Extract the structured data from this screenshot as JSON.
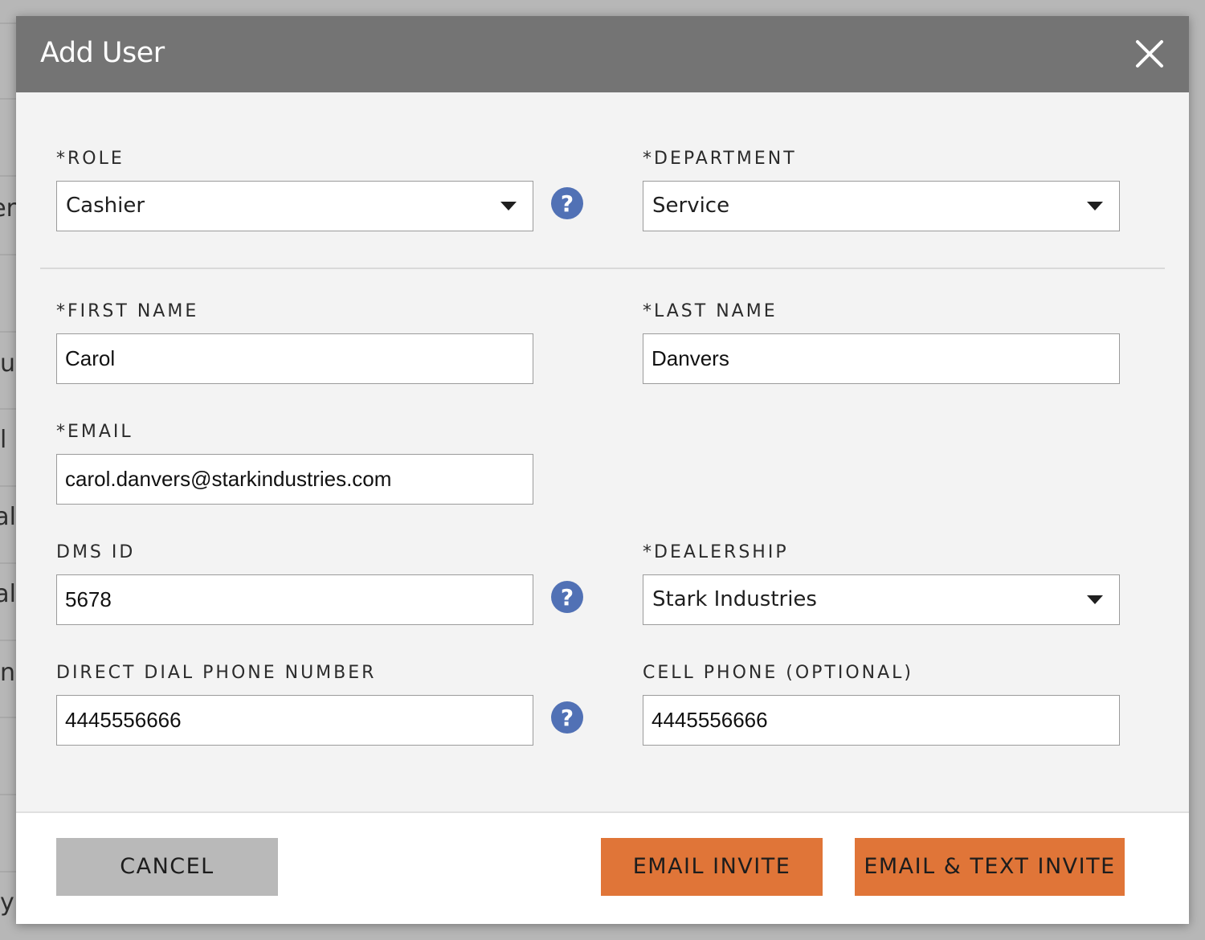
{
  "background": {
    "fragments": [
      "er",
      "u",
      "l",
      "al",
      "al",
      "n",
      "y"
    ]
  },
  "dialog": {
    "title": "Add User",
    "close_icon": "close-icon"
  },
  "form": {
    "role": {
      "label": "*ROLE",
      "value": "Cashier",
      "help_icon": "question-circle-icon"
    },
    "department": {
      "label": "*DEPARTMENT",
      "value": "Service"
    },
    "first_name": {
      "label": "*FIRST NAME",
      "value": "Carol"
    },
    "last_name": {
      "label": "*LAST NAME",
      "value": "Danvers"
    },
    "email": {
      "label": "*EMAIL",
      "value": "carol.danvers@starkindustries.com"
    },
    "dms_id": {
      "label": "DMS ID",
      "value": "5678",
      "help_icon": "question-circle-icon"
    },
    "dealership": {
      "label": "*DEALERSHIP",
      "value": "Stark Industries"
    },
    "direct_dial": {
      "label": "DIRECT DIAL PHONE NUMBER",
      "value": "4445556666",
      "help_icon": "question-circle-icon"
    },
    "cell_phone": {
      "label": "CELL PHONE (OPTIONAL)",
      "value": "4445556666"
    }
  },
  "footer": {
    "cancel_label": "CANCEL",
    "email_invite_label": "EMAIL INVITE",
    "email_text_invite_label": "EMAIL & TEXT INVITE"
  },
  "colors": {
    "header_bg": "#747474",
    "modal_bg": "#f3f3f3",
    "help_icon": "#5171b5",
    "primary_button": "#e07538",
    "cancel_button": "#b9b9b9"
  }
}
